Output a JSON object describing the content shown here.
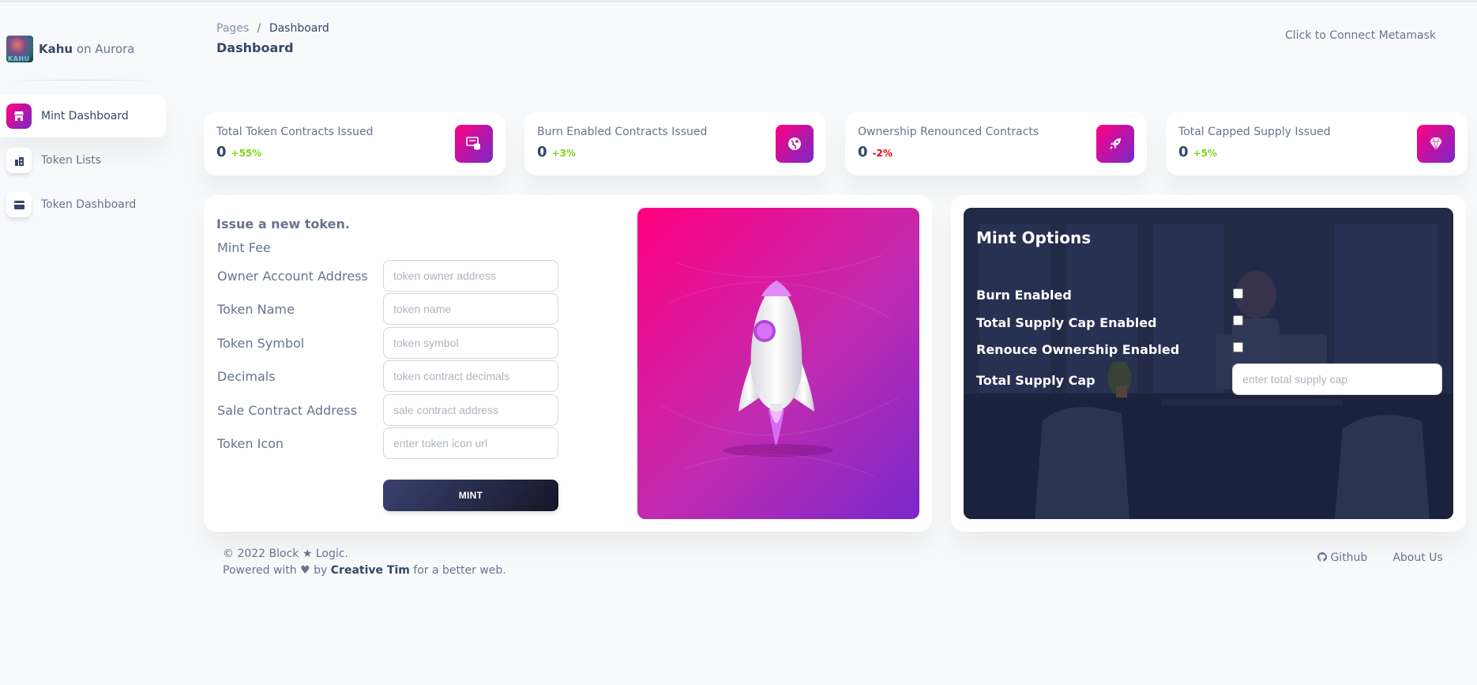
{
  "brand": {
    "name": "Kahu",
    "suffix": "on Aurora",
    "logo_text": "KAHU"
  },
  "sidebar": {
    "items": [
      {
        "label": "Mint Dashboard",
        "icon": "shop-icon",
        "active": true
      },
      {
        "label": "Token Lists",
        "icon": "office-icon",
        "active": false
      },
      {
        "label": "Token Dashboard",
        "icon": "credit-card-icon",
        "active": false
      }
    ]
  },
  "header": {
    "breadcrumb_root": "Pages",
    "breadcrumb_sep": "/",
    "breadcrumb_current": "Dashboard",
    "title": "Dashboard",
    "connect_label": "Click to Connect Metamask"
  },
  "stats": [
    {
      "title": "Total Token Contracts Issued",
      "value": "0",
      "change": "+55%",
      "trend": "up",
      "icon": "screen-icon"
    },
    {
      "title": "Burn Enabled Contracts Issued",
      "value": "0",
      "change": "+3%",
      "trend": "up",
      "icon": "globe-icon"
    },
    {
      "title": "Ownership Renounced Contracts",
      "value": "0",
      "change": "-2%",
      "trend": "down",
      "icon": "rocket-icon"
    },
    {
      "title": "Total Capped Supply Issued",
      "value": "0",
      "change": "+5%",
      "trend": "up",
      "icon": "diamond-icon"
    }
  ],
  "form": {
    "heading": "Issue a new token.",
    "fee_label": "Mint Fee",
    "fields": [
      {
        "label": "Owner Account Address",
        "placeholder": "token owner address"
      },
      {
        "label": "Token Name",
        "placeholder": "token name"
      },
      {
        "label": "Token Symbol",
        "placeholder": "token symbol"
      },
      {
        "label": "Decimals",
        "placeholder": "token contract decimals"
      },
      {
        "label": "Sale Contract Address",
        "placeholder": "sale contract address"
      },
      {
        "label": "Token Icon",
        "placeholder": "enter token icon url"
      }
    ],
    "mint_button": "MINT"
  },
  "options": {
    "title": "Mint Options",
    "burn_label": "Burn Enabled",
    "cap_enabled_label": "Total Supply Cap Enabled",
    "renounce_label": "Renouce Ownership Enabled",
    "cap_label": "Total Supply Cap",
    "cap_placeholder": "enter total supply cap"
  },
  "footer": {
    "copyright": "© 2022 Block ★ Logic.",
    "powered_prefix": "Powered with",
    "powered_by": "by",
    "author": "Creative Tim",
    "powered_suffix": "for a better web.",
    "links": [
      "Github",
      "About Us"
    ]
  },
  "colors": {
    "accent_gradient_start": "#7928ca",
    "accent_gradient_end": "#ff0080",
    "positive": "#82d616",
    "negative": "#ea0606",
    "text": "#344767",
    "muted": "#67748e"
  }
}
